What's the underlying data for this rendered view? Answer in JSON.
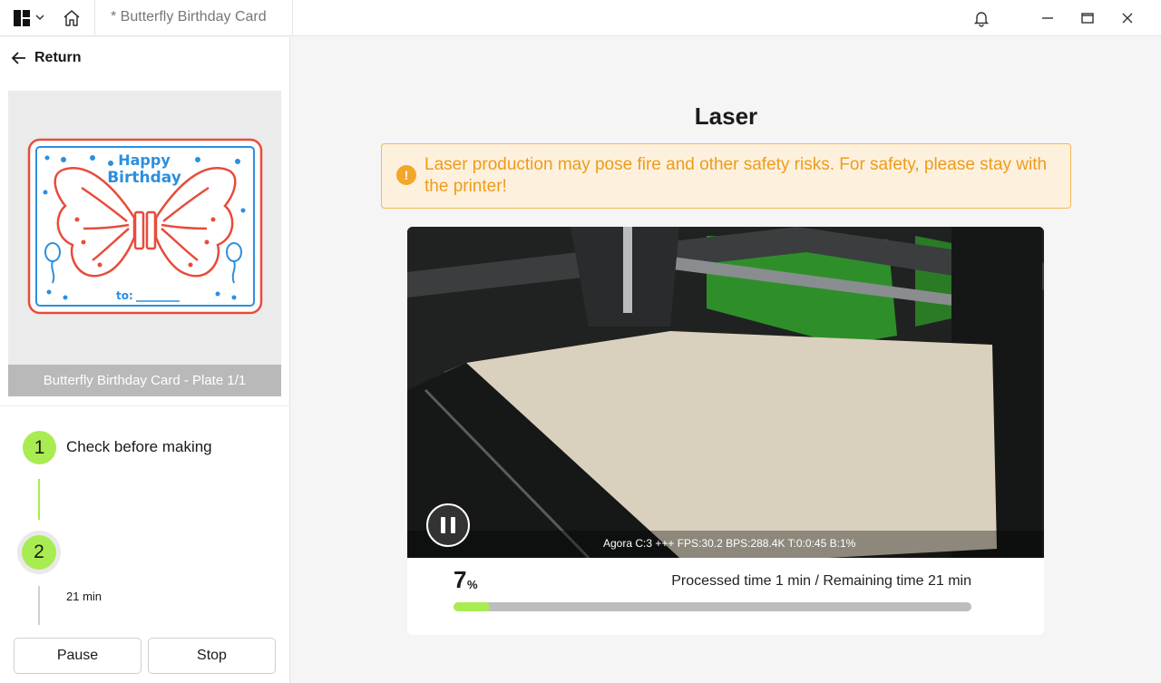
{
  "titlebar": {
    "doc_title": "* Butterfly Birthday Card"
  },
  "sidebar": {
    "return_label": "Return",
    "plate_label": "Butterfly Birthday Card - Plate 1/1",
    "card": {
      "line1": "Happy",
      "line2": "Birthday",
      "to": "to:"
    },
    "steps": [
      {
        "number": "1",
        "label": "Check before making"
      },
      {
        "number": "2",
        "time": "21 min"
      }
    ],
    "pause_label": "Pause",
    "stop_label": "Stop"
  },
  "main": {
    "title": "Laser",
    "warning": "Laser production may pose fire and other safety risks. For safety, please stay with the printer!",
    "video_stats": "Agora C:3 +++ FPS:30.2 BPS:288.4K T:0:0:45 B:1%",
    "progress_percent": "7",
    "percent_sign": "%",
    "progress_value": 7,
    "time_text": "Processed time 1 min / Remaining time 21 min"
  },
  "colors": {
    "accent": "#a9ec52",
    "warning": "#ef9b19",
    "card_red": "#e74c3c",
    "card_blue": "#2b8fe0"
  }
}
